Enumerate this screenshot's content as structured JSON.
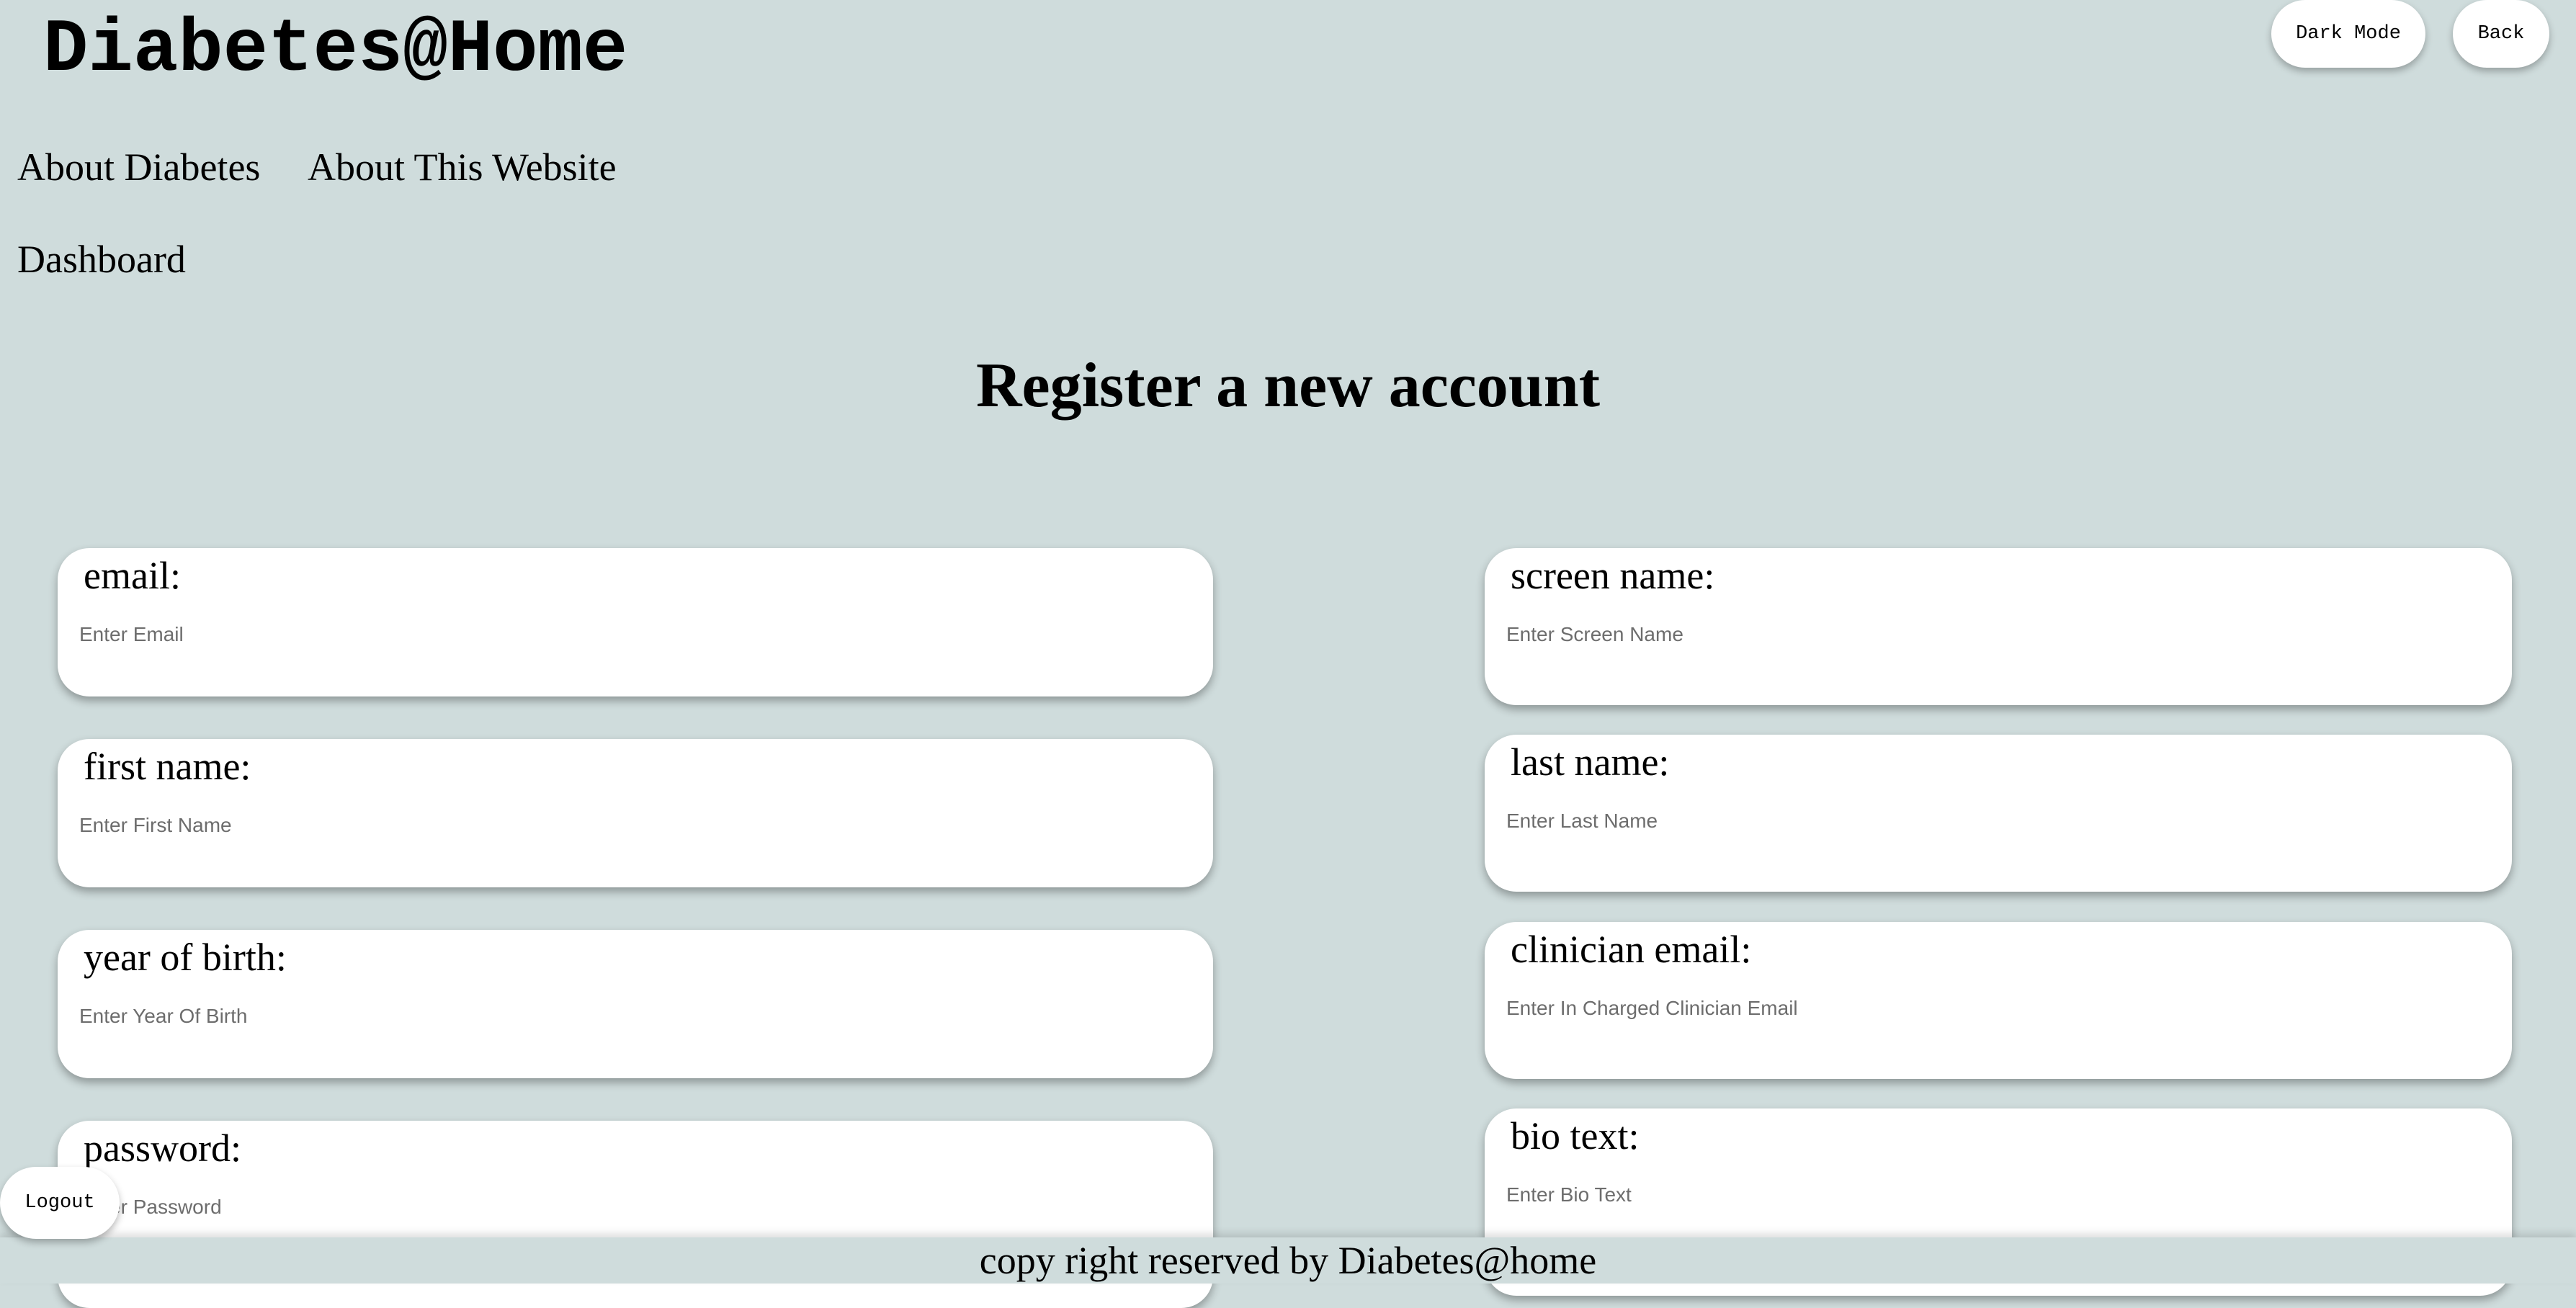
{
  "header": {
    "logo_text": "Diabetes@Home",
    "dark_mode_label": "Dark Mode",
    "back_label": "Back"
  },
  "nav": {
    "about_diabetes": "About Diabetes",
    "about_website": "About This Website",
    "dashboard": "Dashboard"
  },
  "main": {
    "title": "Register a new account"
  },
  "form": {
    "email": {
      "label": "email:",
      "placeholder": "Enter Email"
    },
    "first_name": {
      "label": "first name:",
      "placeholder": "Enter First Name"
    },
    "year_of_birth": {
      "label": "year of birth:",
      "placeholder": "Enter Year Of Birth"
    },
    "password": {
      "label": "password:",
      "placeholder": "Enter Password"
    },
    "screen_name": {
      "label": "screen name:",
      "placeholder": "Enter Screen Name"
    },
    "last_name": {
      "label": "last name:",
      "placeholder": "Enter Last Name"
    },
    "clinician_email": {
      "label": "clinician email:",
      "placeholder": "Enter In Charged Clinician Email"
    },
    "bio_text": {
      "label": "bio text:",
      "placeholder": "Enter Bio Text"
    }
  },
  "logout_label": "Logout",
  "footer": {
    "text": "copy right reserved by Diabetes@home"
  }
}
